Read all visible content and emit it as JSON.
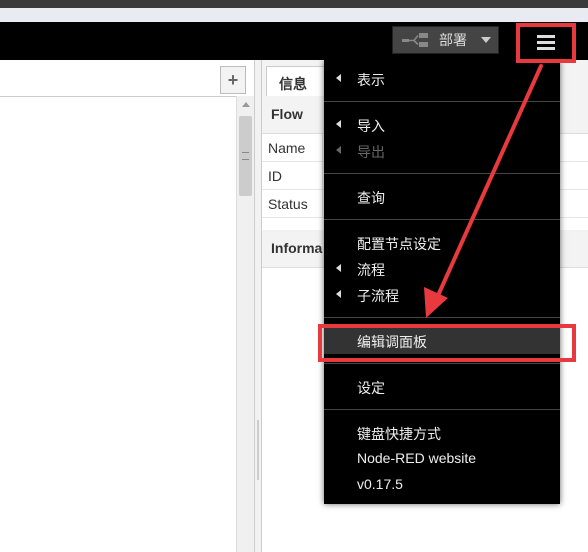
{
  "header": {
    "deploy_label": "部署"
  },
  "sidebar": {
    "info_tab_label": "信息",
    "flow_section_title": "Flow",
    "properties": [
      {
        "label": "Name"
      },
      {
        "label": "ID"
      },
      {
        "label": "Status"
      }
    ],
    "info_section_title": "Informa"
  },
  "workspace": {
    "add_tab_symbol": "+"
  },
  "menu": {
    "items": [
      {
        "label": "表示",
        "submenu": true,
        "disabled": false
      },
      {
        "label": "导入",
        "submenu": true,
        "disabled": false
      },
      {
        "label": "导出",
        "submenu": true,
        "disabled": true
      },
      {
        "label": "查询",
        "submenu": false,
        "disabled": false
      },
      {
        "label": "配置节点设定",
        "submenu": false,
        "disabled": false
      },
      {
        "label": "流程",
        "submenu": true,
        "disabled": false
      },
      {
        "label": "子流程",
        "submenu": true,
        "disabled": false
      },
      {
        "label": "编辑调面板",
        "submenu": false,
        "disabled": false,
        "highlighted": true
      },
      {
        "label": "设定",
        "submenu": false,
        "disabled": false
      },
      {
        "label": "键盘快捷方式",
        "submenu": false,
        "disabled": false
      },
      {
        "label": "Node-RED website",
        "submenu": false,
        "disabled": false
      },
      {
        "label": "v0.17.5",
        "submenu": false,
        "disabled": false
      }
    ]
  },
  "colors": {
    "annotation_red": "#e8393f",
    "header_bg": "#000000",
    "menu_bg": "#000000"
  }
}
